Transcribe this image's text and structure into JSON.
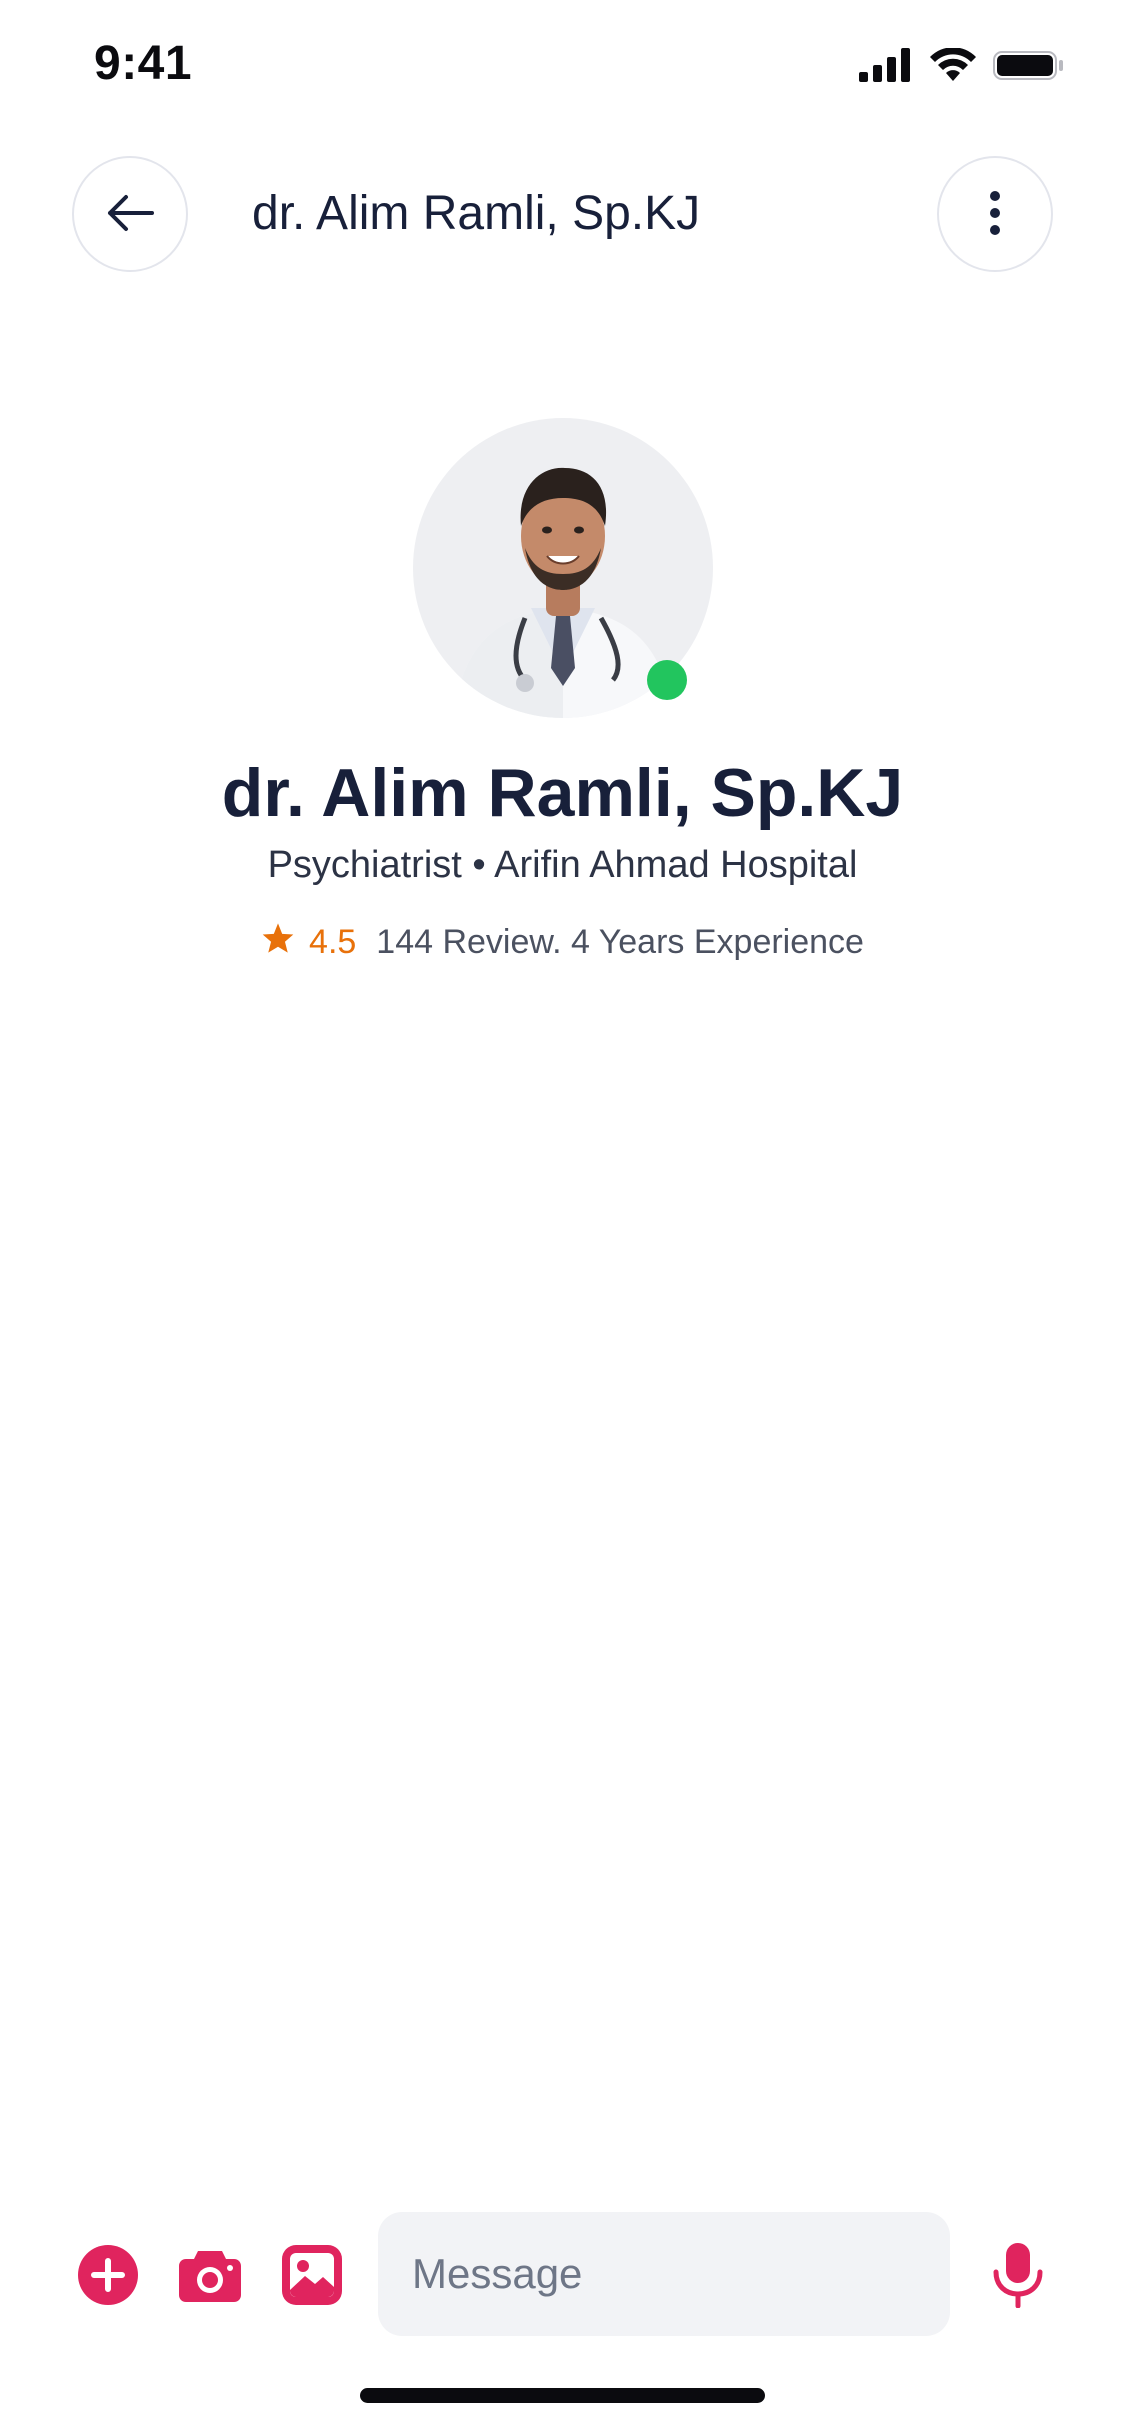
{
  "status_bar": {
    "time": "9:41",
    "icons": [
      "cellular-signal-icon",
      "wifi-icon",
      "battery-icon"
    ]
  },
  "header": {
    "title": "dr. Alim Ramli, Sp.KJ",
    "back_icon": "arrow-left-icon",
    "more_icon": "more-vertical-icon"
  },
  "profile": {
    "name": "dr. Alim Ramli, Sp.KJ",
    "specialty_line": "Psychiatrist • Arifin Ahmad Hospital",
    "rating": "4.5",
    "meta": "144 Review. 4 Years Experience",
    "online": true,
    "online_color": "#22c55e"
  },
  "composer": {
    "placeholder": "Message",
    "value": "",
    "icons": [
      "plus-circle-icon",
      "camera-icon",
      "image-icon",
      "microphone-icon"
    ],
    "accent_color": "#e0245e"
  },
  "colors": {
    "text_primary": "#18203a",
    "rating_accent": "#e8710a",
    "input_bg": "#f2f3f6"
  }
}
